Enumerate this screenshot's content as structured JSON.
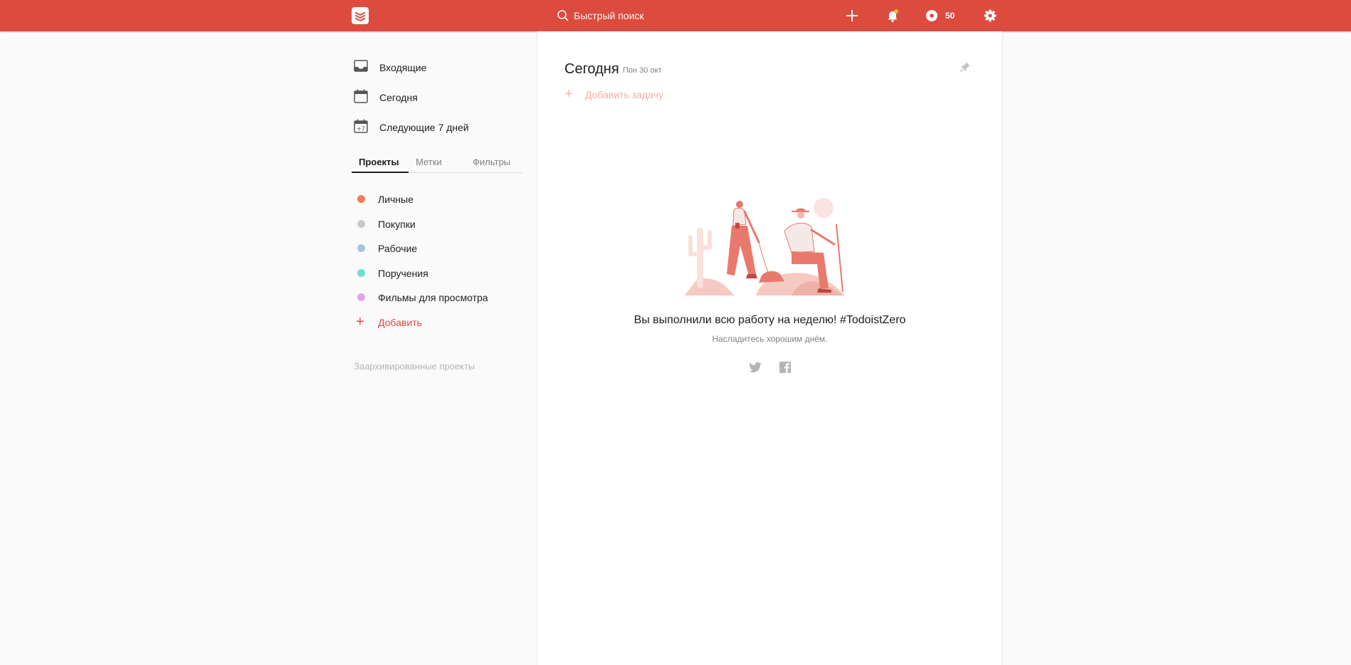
{
  "topbar": {
    "search_placeholder": "Быстрый поиск",
    "karma_count": "50",
    "accent_color": "#db4c3f"
  },
  "sidebar": {
    "nav": [
      {
        "label": "Входящие",
        "icon": "inbox-icon"
      },
      {
        "label": "Сегодня",
        "icon": "calendar-today-icon"
      },
      {
        "label": "Следующие 7 дней",
        "icon": "calendar-next7-icon"
      }
    ],
    "tabs": [
      "Проекты",
      "Метки",
      "Фильтры"
    ],
    "active_tab": "Проекты",
    "projects": [
      {
        "label": "Личные",
        "color": "#f27c5d"
      },
      {
        "label": "Покупки",
        "color": "#c9c9c9"
      },
      {
        "label": "Рабочие",
        "color": "#a8c4e0"
      },
      {
        "label": "Поручения",
        "color": "#6ce0cd"
      },
      {
        "label": "Фильмы для просмотра",
        "color": "#e0a6e6"
      }
    ],
    "add_label": "Добавить",
    "archived_label": "Заархивированные проекты"
  },
  "main": {
    "title": "Сегодня",
    "subtitle": "Пон 30 окт",
    "add_task": "Добавить задачу",
    "zero_title": "Вы выполнили всю работу на неделю! #TodoistZero",
    "zero_sub": "Насладитесь хорошим днём."
  }
}
